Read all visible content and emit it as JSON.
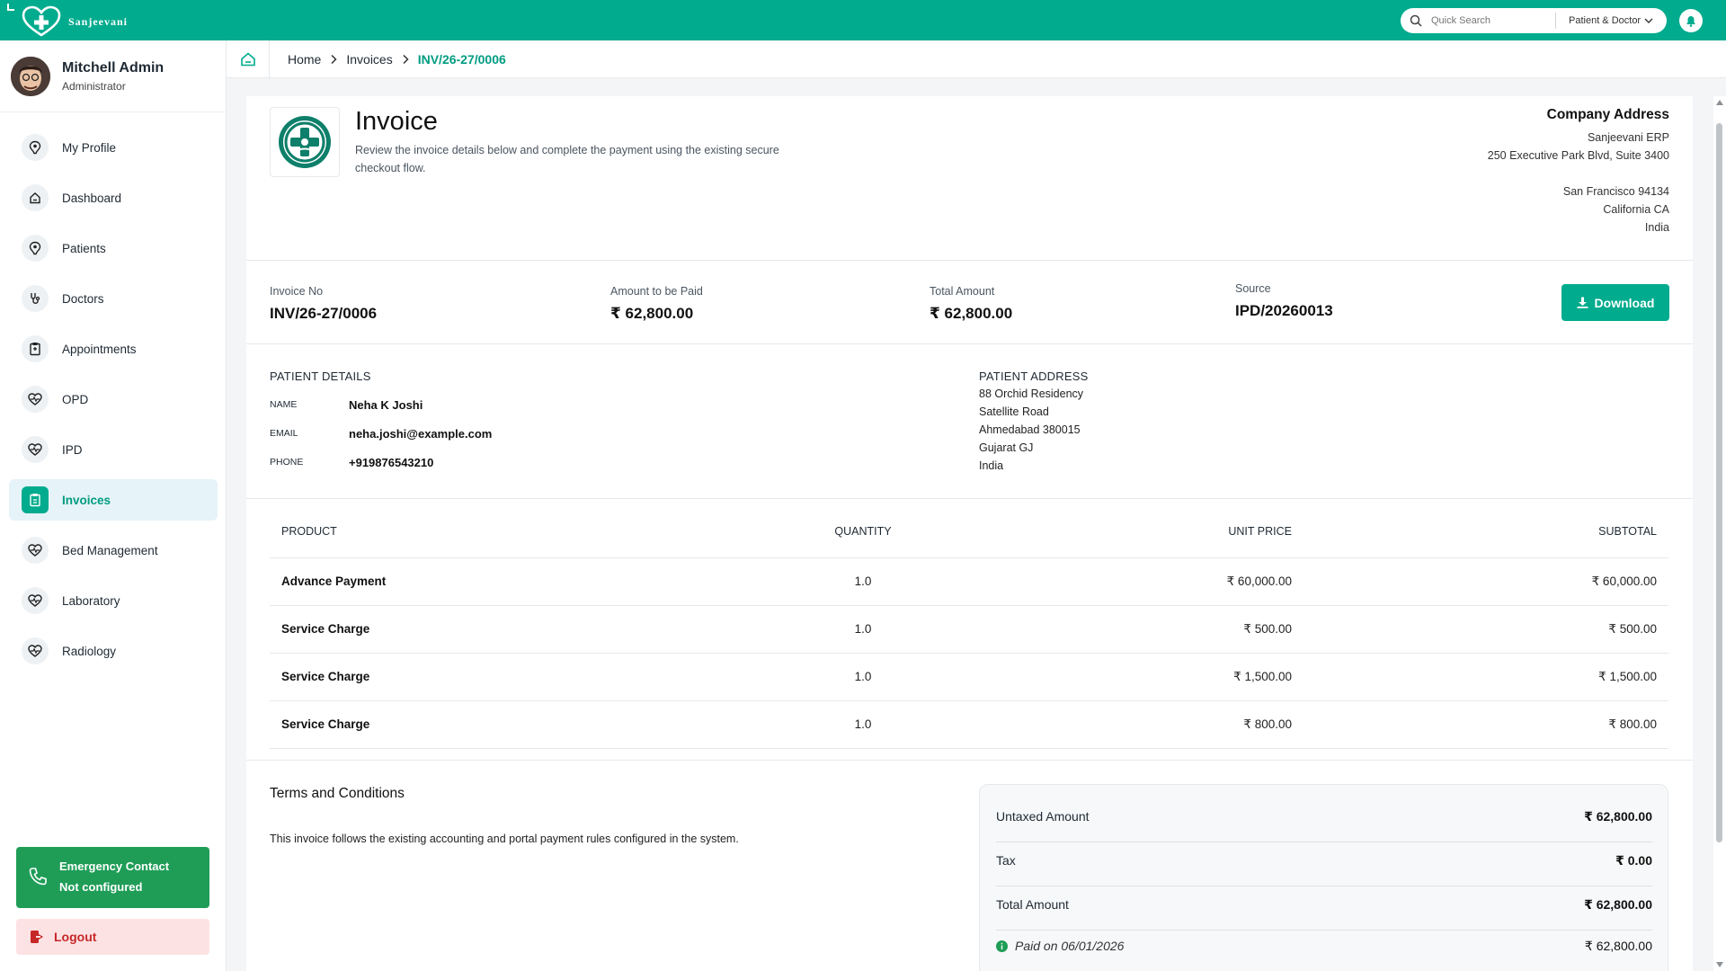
{
  "app": {
    "brand": "Sanjeevani",
    "accent": "#00ab8e"
  },
  "search": {
    "placeholder": "Quick Search",
    "filter": "Patient & Doctor"
  },
  "user": {
    "name": "Mitchell Admin",
    "role": "Administrator"
  },
  "sidebar": {
    "items": [
      {
        "label": "My Profile",
        "icon": "profile-icon"
      },
      {
        "label": "Dashboard",
        "icon": "home-icon"
      },
      {
        "label": "Patients",
        "icon": "patient-icon"
      },
      {
        "label": "Doctors",
        "icon": "stethoscope-icon"
      },
      {
        "label": "Appointments",
        "icon": "clipboard-icon"
      },
      {
        "label": "OPD",
        "icon": "heart-pulse-icon"
      },
      {
        "label": "IPD",
        "icon": "heart-pulse-icon"
      },
      {
        "label": "Invoices",
        "icon": "clipboard-icon",
        "active": true
      },
      {
        "label": "Bed Management",
        "icon": "heart-pulse-icon"
      },
      {
        "label": "Laboratory",
        "icon": "heart-pulse-icon"
      },
      {
        "label": "Radiology",
        "icon": "heart-pulse-icon"
      }
    ],
    "emergency": {
      "title": "Emergency Contact",
      "status": "Not configured"
    },
    "logout": "Logout"
  },
  "breadcrumb": {
    "home": "Home",
    "section": "Invoices",
    "current": "INV/26-27/0006"
  },
  "invoice": {
    "title": "Invoice",
    "description": "Review the invoice details below and complete the payment using the existing secure checkout flow.",
    "company": {
      "title": "Company Address",
      "lines": [
        "Sanjeevani ERP",
        "250 Executive Park Blvd, Suite 3400"
      ],
      "lines2": [
        "San Francisco 94134",
        "California CA",
        "India"
      ]
    },
    "summary": {
      "invoice_no_label": "Invoice No",
      "invoice_no": "INV/26-27/0006",
      "amount_due_label": "Amount to be Paid",
      "amount_due": "₹ 62,800.00",
      "total_label": "Total Amount",
      "total": "₹ 62,800.00",
      "source_label": "Source",
      "source": "IPD/20260013"
    },
    "download_label": "Download",
    "patient": {
      "section_title": "PATIENT DETAILS",
      "name_label": "NAME",
      "name": "Neha K Joshi",
      "email_label": "EMAIL",
      "email": "neha.joshi@example.com",
      "phone_label": "PHONE",
      "phone": "+919876543210"
    },
    "address": {
      "section_title": "PATIENT ADDRESS",
      "lines": [
        "88 Orchid Residency",
        "Satellite Road",
        "Ahmedabad 380015",
        "Gujarat GJ",
        "India"
      ]
    },
    "table": {
      "headers": [
        "PRODUCT",
        "QUANTITY",
        "UNIT PRICE",
        "SUBTOTAL"
      ],
      "rows": [
        {
          "product": "Advance Payment",
          "qty": "1.0",
          "price": "₹ 60,000.00",
          "subtotal": "₹ 60,000.00"
        },
        {
          "product": "Service Charge",
          "qty": "1.0",
          "price": "₹ 500.00",
          "subtotal": "₹ 500.00"
        },
        {
          "product": "Service Charge",
          "qty": "1.0",
          "price": "₹ 1,500.00",
          "subtotal": "₹ 1,500.00"
        },
        {
          "product": "Service Charge",
          "qty": "1.0",
          "price": "₹ 800.00",
          "subtotal": "₹ 800.00"
        }
      ]
    },
    "terms": {
      "title": "Terms and Conditions",
      "text": "This invoice follows the existing accounting and portal payment rules configured in the system."
    },
    "totals": {
      "untaxed_label": "Untaxed Amount",
      "untaxed": "₹ 62,800.00",
      "tax_label": "Tax",
      "tax": "₹ 0.00",
      "total_label": "Total Amount",
      "total": "₹ 62,800.00",
      "paid_label": "Paid on 06/01/2026",
      "paid": "₹ 62,800.00"
    }
  }
}
